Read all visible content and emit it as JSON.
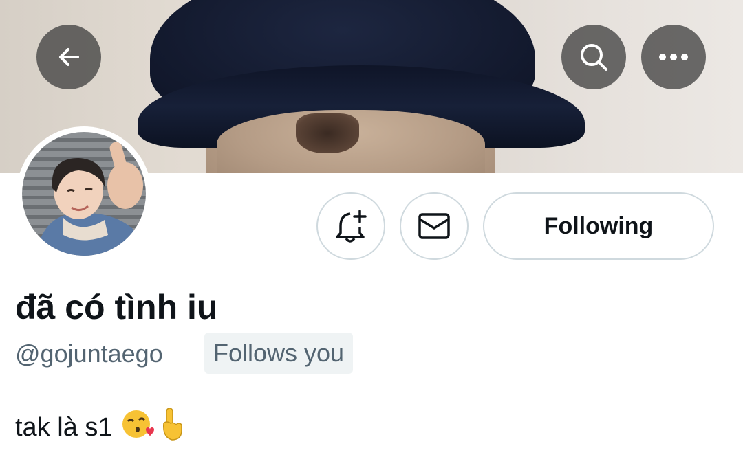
{
  "header": {
    "back_icon": "arrow-left-icon",
    "search_icon": "search-icon",
    "more_icon": "more-horizontal-icon"
  },
  "actions": {
    "notify_icon": "bell-plus-icon",
    "message_icon": "envelope-icon",
    "following_label": "Following"
  },
  "profile": {
    "display_name": "đã có tình iu",
    "handle": "@gojuntaego",
    "follows_you": "Follows you",
    "bio_text": "tak là s1",
    "bio_emojis": [
      "kissing-face-with-heart",
      "index-pointing-up"
    ]
  },
  "colors": {
    "primary_text": "#0f1419",
    "secondary_text": "#536471",
    "border": "#cfd9de",
    "badge_bg": "#eff3f4"
  }
}
